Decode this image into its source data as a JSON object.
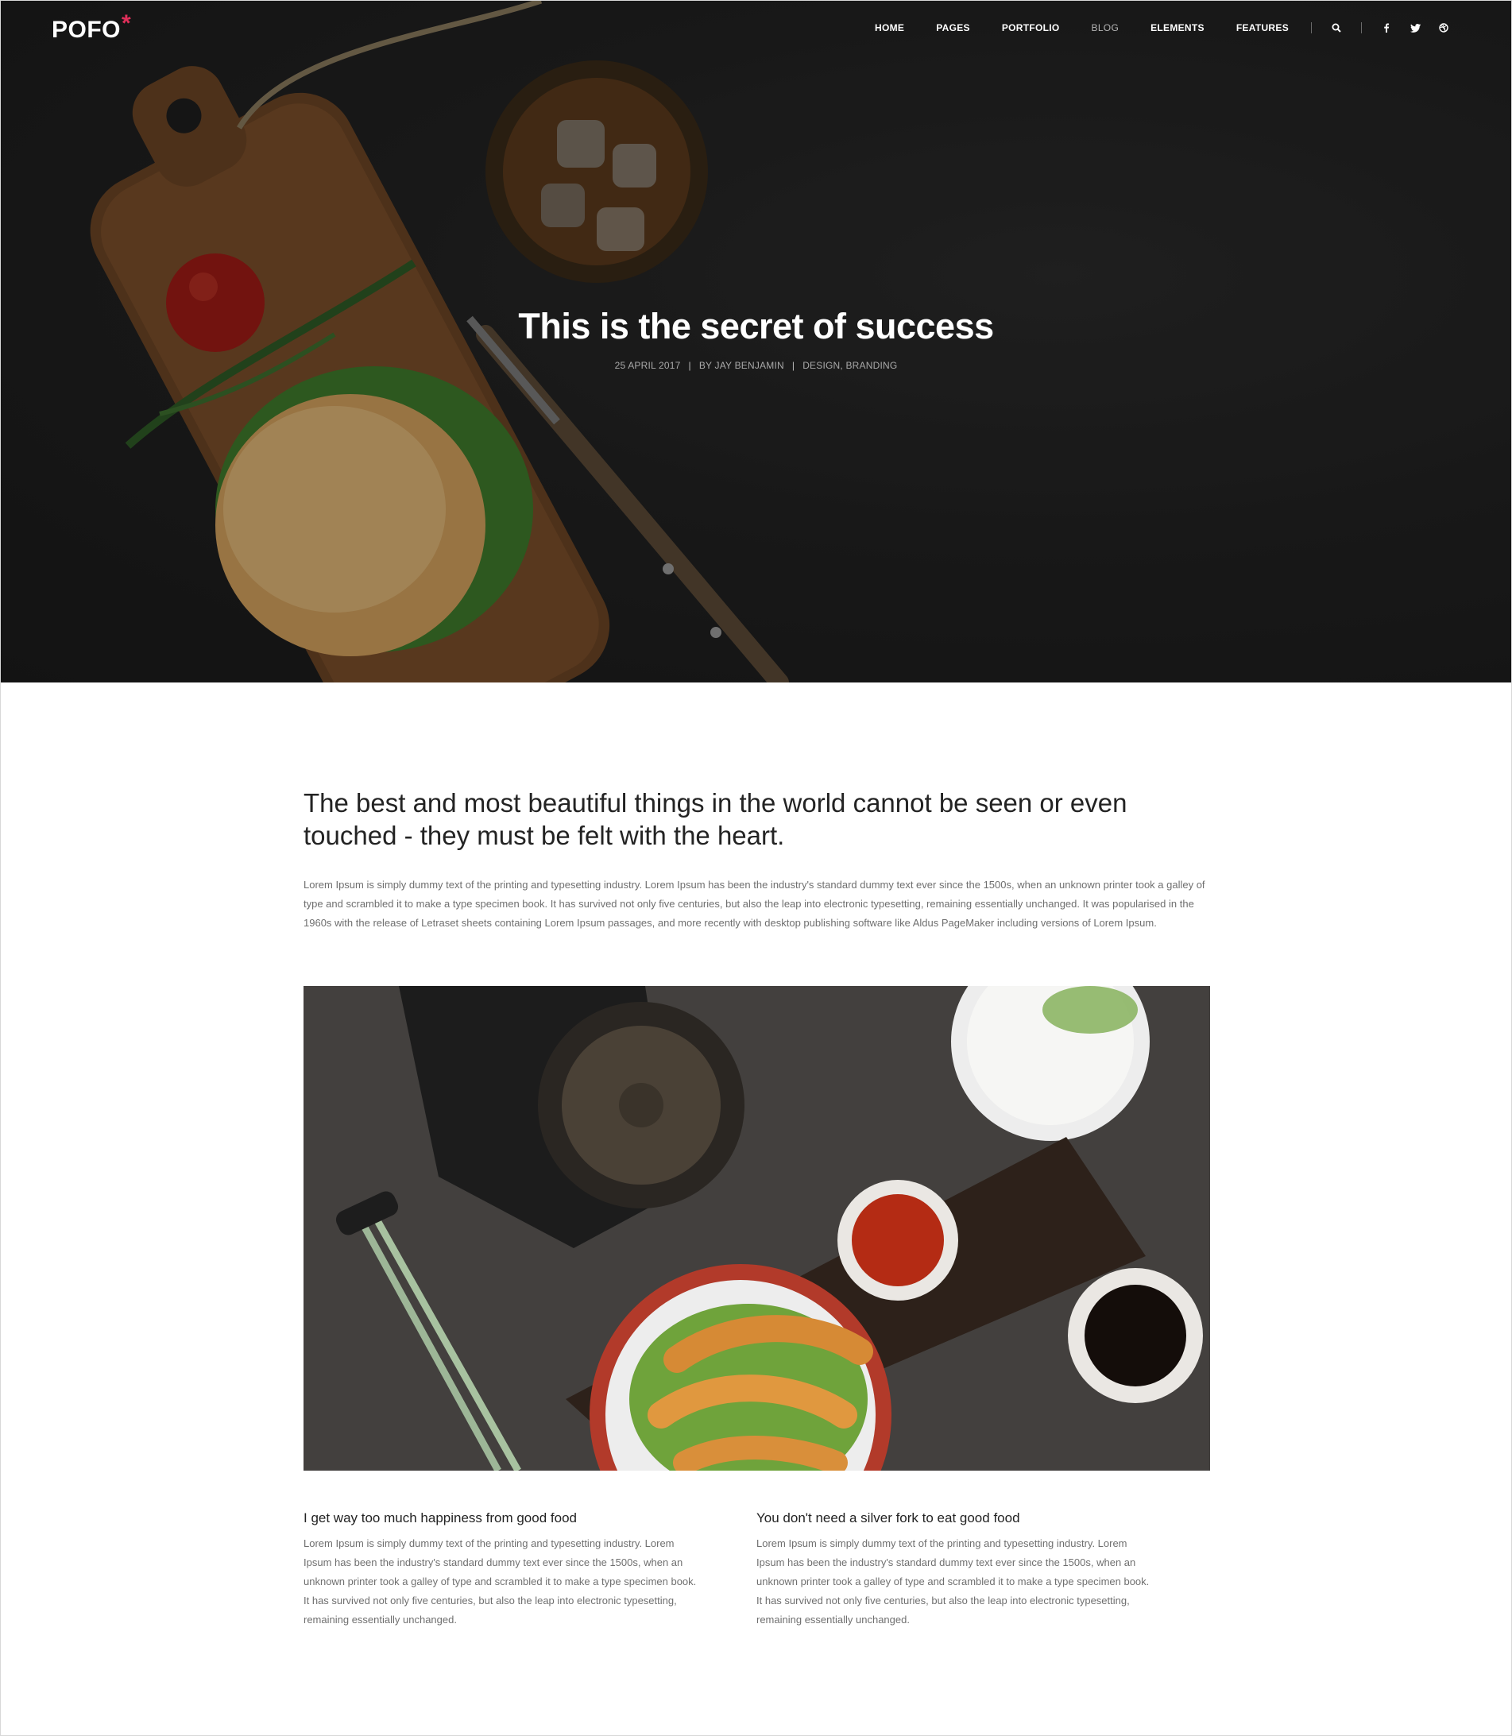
{
  "brand": {
    "logo_text": "POFO",
    "logo_mark": "*",
    "accent_color": "#e02f5a"
  },
  "nav": {
    "items": [
      {
        "label": "HOME",
        "active": false
      },
      {
        "label": "PAGES",
        "active": false
      },
      {
        "label": "PORTFOLIO",
        "active": false
      },
      {
        "label": "BLOG",
        "active": true
      },
      {
        "label": "ELEMENTS",
        "active": false
      },
      {
        "label": "FEATURES",
        "active": false
      }
    ],
    "icons": [
      "search-icon",
      "facebook-icon",
      "twitter-icon",
      "dribbble-icon"
    ]
  },
  "hero": {
    "title": "This is the secret of success",
    "date": "25 APRIL 2017",
    "author": "BY JAY BENJAMIN",
    "categories": "DESIGN, BRANDING"
  },
  "article": {
    "quote": "The best and most beautiful things in the world cannot be seen or even touched - they must be felt with the heart.",
    "intro": "Lorem Ipsum is simply dummy text of the printing and typesetting industry. Lorem Ipsum has been the industry's standard dummy text ever since the 1500s, when an unknown printer took a galley of type and scrambled it to make a type specimen book. It has survived not only five centuries, but also the leap into electronic typesetting, remaining essentially unchanged. It was popularised in the 1960s with the release of Letraset sheets containing Lorem Ipsum passages, and more recently with desktop publishing software like Aldus PageMaker including versions of Lorem Ipsum.",
    "columns": [
      {
        "title": "I get way too much happiness from good food",
        "text": "Lorem Ipsum is simply dummy text of the printing and typesetting industry. Lorem Ipsum has been the industry's standard dummy text ever since the 1500s, when an unknown printer took a galley of type and scrambled it to make a type specimen book. It has survived not only five centuries, but also the leap into electronic typesetting, remaining essentially unchanged."
      },
      {
        "title": "You don't need a silver fork to eat good food",
        "text": "Lorem Ipsum is simply dummy text of the printing and typesetting industry. Lorem Ipsum has been the industry's standard dummy text ever since the 1500s, when an unknown printer took a galley of type and scrambled it to make a type specimen book. It has survived not only five centuries, but also the leap into electronic typesetting, remaining essentially unchanged."
      }
    ]
  }
}
